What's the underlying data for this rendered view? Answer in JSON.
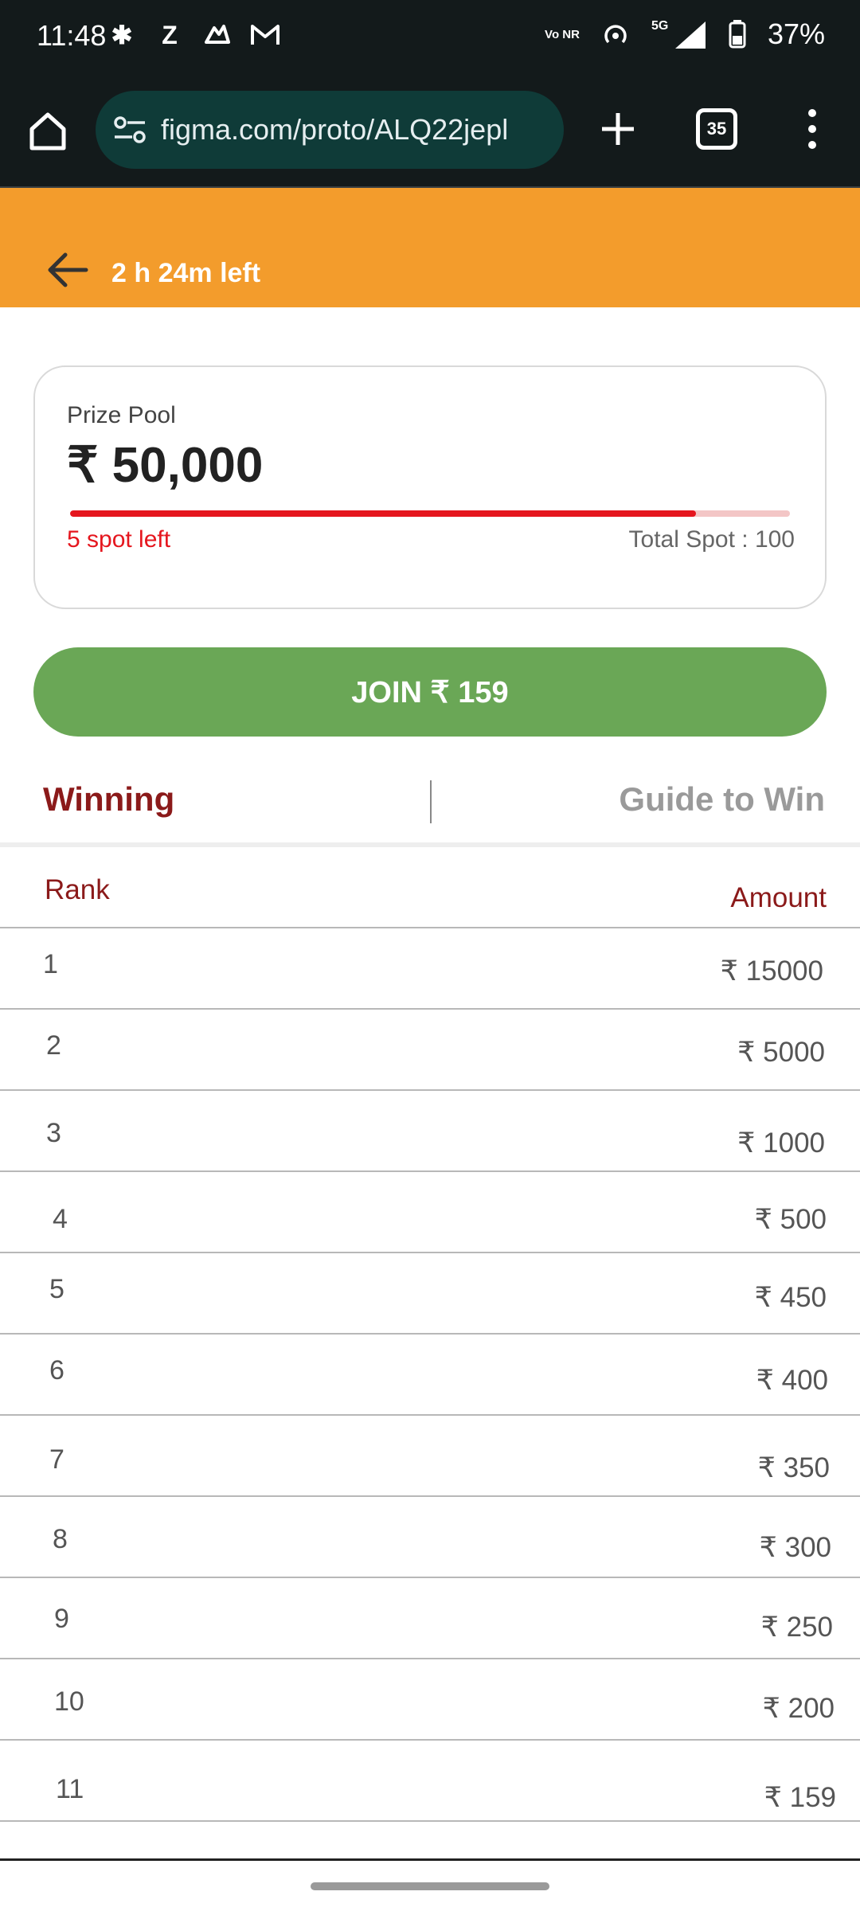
{
  "status_bar": {
    "time": "11:48",
    "icons": [
      "slack-icon",
      "z-icon",
      "app-icon",
      "gmail-icon",
      "vonr-icon",
      "hotspot-icon",
      "signal-5g-icon",
      "battery-icon"
    ],
    "vonr": "Vo NR",
    "network": "5G",
    "battery": "37%"
  },
  "browser": {
    "url": "figma.com/proto/ALQ22jepl",
    "tab_count": "35"
  },
  "header": {
    "time_left": "2 h 24m left",
    "background": "#f39c2c"
  },
  "prize_card": {
    "label": "Prize Pool",
    "amount": "₹ 50,000",
    "progress_fraction": 0.87,
    "spots_left": "5 spot left",
    "total_spot": "Total Spot : 100"
  },
  "join_button": {
    "label": "JOIN ₹ 159",
    "color": "#6aa756"
  },
  "tabs": {
    "winning": "Winning",
    "guide": "Guide to Win"
  },
  "table": {
    "rank_header": "Rank",
    "amount_header": "Amount",
    "rows": [
      {
        "rank": "1",
        "amount": "₹ 15000"
      },
      {
        "rank": "2",
        "amount": "₹ 5000"
      },
      {
        "rank": "3",
        "amount": "₹ 1000"
      },
      {
        "rank": "4",
        "amount": "₹ 500"
      },
      {
        "rank": "5",
        "amount": "₹ 450"
      },
      {
        "rank": "6",
        "amount": "₹ 400"
      },
      {
        "rank": "7",
        "amount": "₹ 350"
      },
      {
        "rank": "8",
        "amount": "₹ 300"
      },
      {
        "rank": "9",
        "amount": "₹ 250"
      },
      {
        "rank": "10",
        "amount": "₹ 200"
      },
      {
        "rank": "11",
        "amount": "₹ 159"
      }
    ]
  },
  "colors": {
    "accent_red": "#e5161e",
    "dark_red": "#8b1a1a",
    "browser_dark": "#131a1b"
  }
}
